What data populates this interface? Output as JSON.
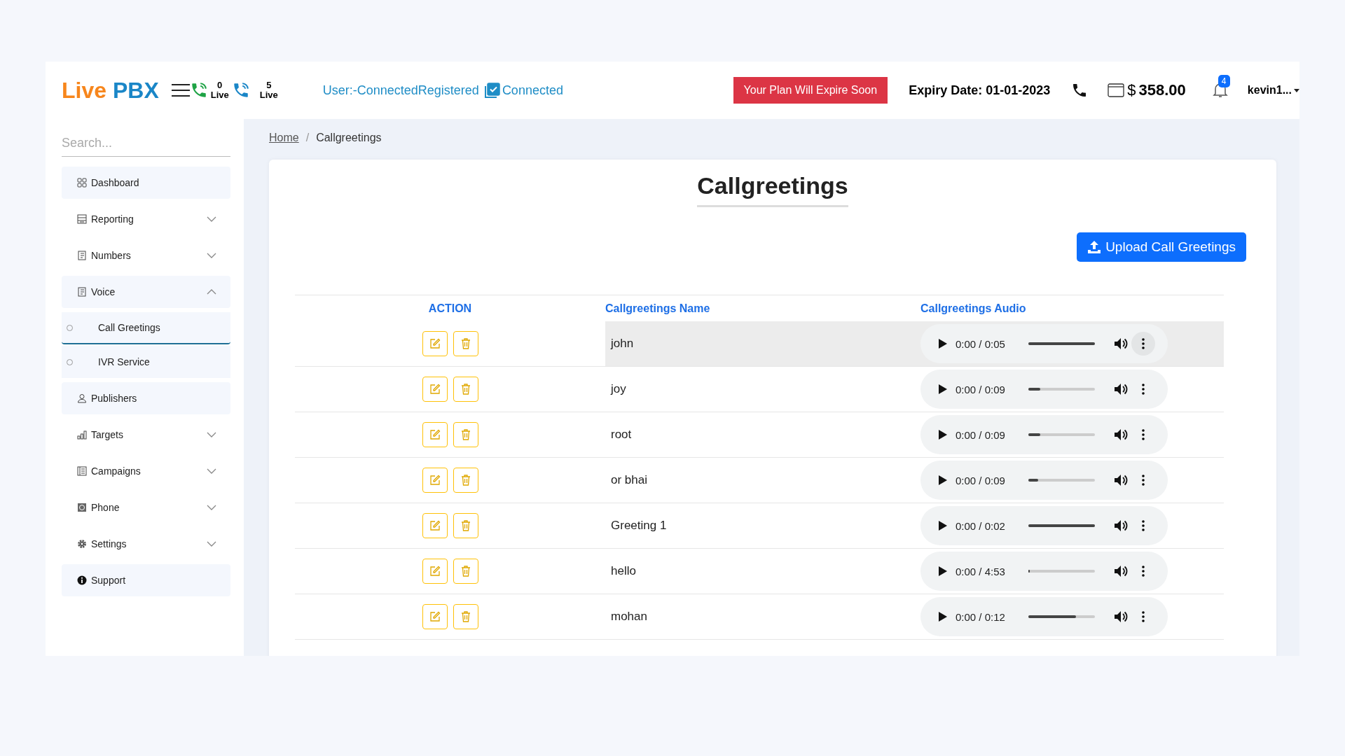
{
  "header": {
    "logo": {
      "part_1": "Live",
      "part_2": "PBX"
    },
    "counters": [
      {
        "value": "0",
        "label": "Live"
      },
      {
        "value": "5",
        "label": "Live"
      }
    ],
    "status": "User:-ConnectedRegistered",
    "connection": {
      "label": "Connected",
      "checked": true
    },
    "plan_alert": "Your Plan Will Expire Soon",
    "expiry": "Expiry Date: 01-01-2023",
    "balance": {
      "currency": "$",
      "amount": "358.00"
    },
    "notifications": "4",
    "user": "kevin1..."
  },
  "sidebar": {
    "search": {
      "placeholder": "Search..."
    },
    "items": [
      {
        "kind": "link",
        "label": "Dashboard"
      },
      {
        "kind": "group",
        "label": "Reporting",
        "expanded": false
      },
      {
        "kind": "group",
        "label": "Numbers",
        "expanded": false
      },
      {
        "kind": "group",
        "label": "Voice",
        "expanded": true,
        "children": [
          {
            "label": "Call Greetings",
            "selected": true
          },
          {
            "label": "IVR Service",
            "selected": false
          }
        ]
      },
      {
        "kind": "link",
        "label": "Publishers"
      },
      {
        "kind": "group",
        "label": "Targets",
        "expanded": false
      },
      {
        "kind": "group",
        "label": "Campaigns",
        "expanded": false
      },
      {
        "kind": "group",
        "label": "Phone",
        "expanded": false
      },
      {
        "kind": "group",
        "label": "Settings",
        "expanded": false
      },
      {
        "kind": "link",
        "label": "Support"
      }
    ]
  },
  "breadcrumb": {
    "items": [
      "Home",
      "Callgreetings"
    ],
    "separator": "/"
  },
  "page": {
    "title": "Callgreetings",
    "upload_button": "Upload Call Greetings"
  },
  "table": {
    "columns": [
      "ACTION",
      "Callgreetings Name",
      "Callgreetings Audio"
    ],
    "rows": [
      {
        "name": "john",
        "time": "0:00 / 0:05",
        "level": 1,
        "selected": true
      },
      {
        "name": "joy",
        "time": "0:00 / 0:09",
        "level": 0.18,
        "selected": false
      },
      {
        "name": "root",
        "time": "0:00 / 0:09",
        "level": 0.18,
        "selected": false
      },
      {
        "name": "or bhai",
        "time": "0:00 / 0:09",
        "level": 0.15,
        "selected": false
      },
      {
        "name": "Greeting 1",
        "time": "0:00 / 0:02",
        "level": 1,
        "selected": false
      },
      {
        "name": "hello",
        "time": "0:00 / 4:53",
        "level": 0.02,
        "selected": false
      },
      {
        "name": "mohan",
        "time": "0:00 / 0:12",
        "level": 0.72,
        "selected": false
      }
    ]
  }
}
